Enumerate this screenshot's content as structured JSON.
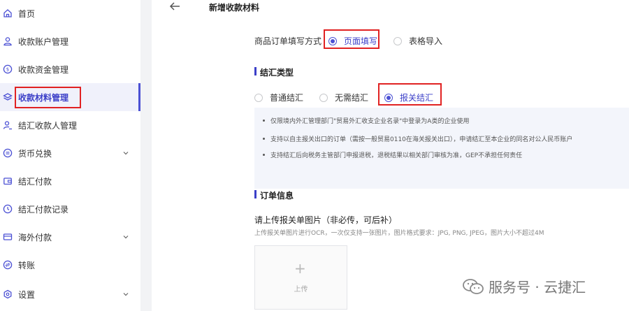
{
  "sidebar": {
    "items": [
      {
        "label": "首页",
        "icon": "home-icon"
      },
      {
        "label": "收款账户管理",
        "icon": "user-icon"
      },
      {
        "label": "收款资金管理",
        "icon": "dollar-circle-icon"
      },
      {
        "label": "收款材料管理",
        "icon": "layers-icon",
        "active": true
      },
      {
        "label": "结汇收款人管理",
        "icon": "user-edit-icon"
      },
      {
        "label": "货币兑换",
        "icon": "exchange-icon",
        "expandable": true
      },
      {
        "label": "结汇付款",
        "icon": "wallet-icon"
      },
      {
        "label": "结汇付款记录",
        "icon": "clock-icon"
      },
      {
        "label": "海外付款",
        "icon": "card-icon",
        "expandable": true
      },
      {
        "label": "转账",
        "icon": "transfer-icon"
      },
      {
        "label": "设置",
        "icon": "settings-icon",
        "expandable": true
      }
    ]
  },
  "header": {
    "title": "新增收款材料"
  },
  "order_fill": {
    "label": "商品订单填写方式",
    "options": [
      "页面填写",
      "表格导入"
    ],
    "selected": "页面填写"
  },
  "settlement": {
    "section_title": "结汇类型",
    "options": [
      "普通结汇",
      "无需结汇",
      "报关结汇"
    ],
    "selected": "报关结汇",
    "notes": [
      "仅限境内外汇管理部门\"贸易外汇收支企业名录\"中登录为A类的企业使用",
      "支持以自主报关出口的订单（需按一般贸易0110在海关报关出口），申请结汇至本企业的同名对公人民币账户",
      "支持结汇后向税务主管部门申报退税，退税结果以相关部门审核为准，GEP不承担任何责任"
    ]
  },
  "order_info": {
    "section_title": "订单信息",
    "upload_title": "请上传报关单图片（非必传，可后补）",
    "upload_hint": "上传报关单图片进行OCR，一次仅支持一张图片，图片格式要求：JPG, PNG, JPEG，图片大小不超过4M",
    "upload_button": "上传",
    "plus_symbol": "+"
  },
  "watermark": {
    "text": "服务号 · 云捷汇"
  },
  "colors": {
    "accent": "#4b50d4",
    "highlight_box": "#e12222"
  }
}
